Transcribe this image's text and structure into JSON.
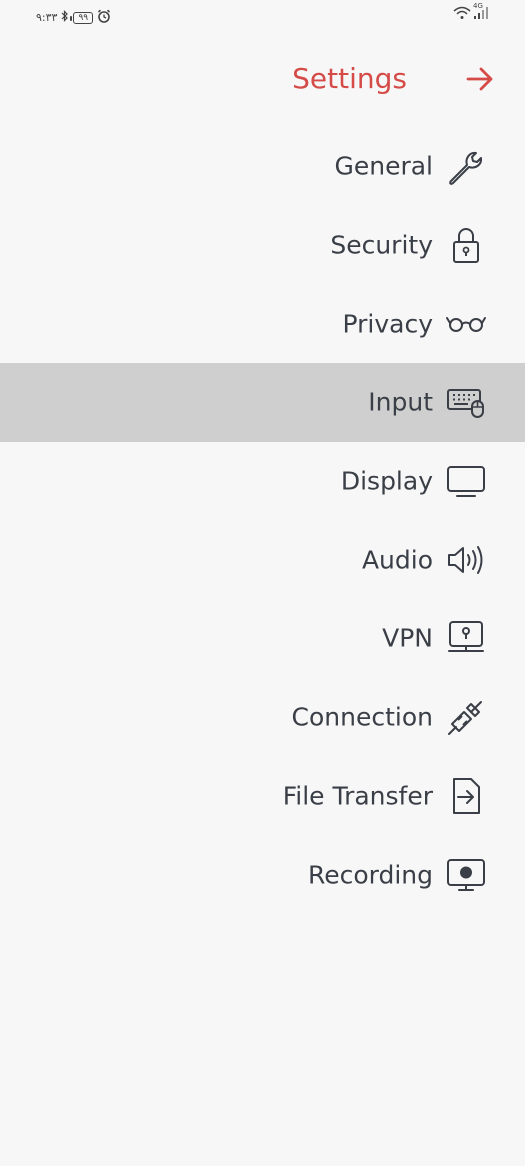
{
  "status_bar": {
    "time": "۹:۳۳",
    "battery": "۹۹",
    "network": "4G"
  },
  "header": {
    "title": "Settings",
    "accent_color": "#d44b48",
    "back_icon": "arrow-right-icon"
  },
  "menu": {
    "selected": "Input",
    "items": [
      {
        "label": "General",
        "icon": "wrench-icon"
      },
      {
        "label": "Security",
        "icon": "lock-icon"
      },
      {
        "label": "Privacy",
        "icon": "glasses-icon"
      },
      {
        "label": "Input",
        "icon": "keyboard-mouse-icon"
      },
      {
        "label": "Display",
        "icon": "monitor-icon"
      },
      {
        "label": "Audio",
        "icon": "speaker-icon"
      },
      {
        "label": "VPN",
        "icon": "monitor-lock-icon"
      },
      {
        "label": "Connection",
        "icon": "plug-disconnected-icon"
      },
      {
        "label": "File Transfer",
        "icon": "file-arrow-icon"
      },
      {
        "label": "Recording",
        "icon": "screen-record-icon"
      }
    ]
  }
}
